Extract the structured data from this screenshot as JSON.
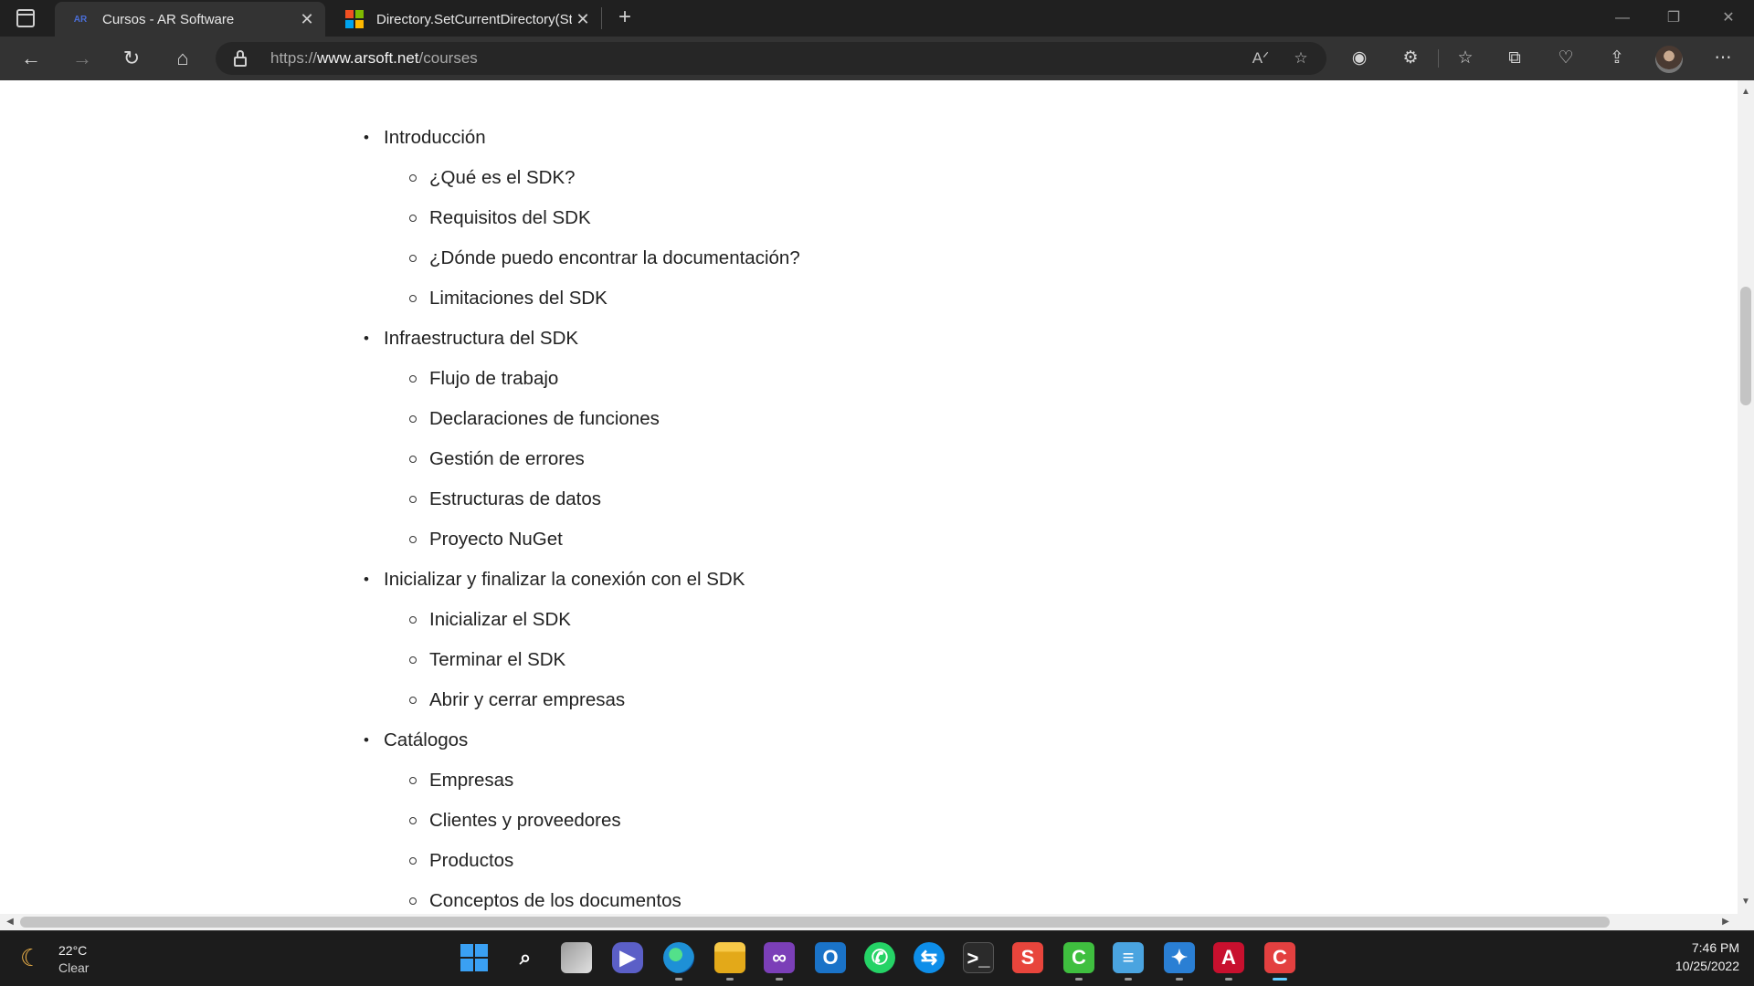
{
  "browser": {
    "tabs": [
      {
        "title": "Cursos - AR Software",
        "favicon": "ar-software-favicon",
        "active": true
      },
      {
        "title": "Directory.SetCurrentDirectory(St",
        "favicon": "microsoft-favicon",
        "active": false
      }
    ],
    "url_prefix": "https://",
    "url_domain": "www.arsoft.net",
    "url_path": "/courses"
  },
  "course_outline": [
    {
      "label": "Introducción",
      "subitems": [
        "¿Qué es el SDK?",
        "Requisitos del SDK",
        "¿Dónde puedo encontrar la documentación?",
        "Limitaciones del SDK"
      ]
    },
    {
      "label": "Infraestructura del SDK",
      "subitems": [
        "Flujo de trabajo",
        "Declaraciones de funciones",
        "Gestión de errores",
        "Estructuras de datos",
        "Proyecto NuGet"
      ]
    },
    {
      "label": "Inicializar y finalizar la conexión con el SDK",
      "subitems": [
        "Inicializar el SDK",
        "Terminar el SDK",
        "Abrir y cerrar empresas"
      ]
    },
    {
      "label": "Catálogos",
      "subitems": [
        "Empresas",
        "Clientes y proveedores",
        "Productos",
        "Conceptos de los documentos"
      ]
    }
  ],
  "taskbar": {
    "weather": {
      "temp": "22°C",
      "condition": "Clear"
    },
    "apps": [
      "start",
      "search",
      "task-view",
      "teams",
      "edge",
      "file-explorer",
      "visual-studio",
      "outlook",
      "whatsapp",
      "teamviewer",
      "terminal",
      "sublime",
      "app-green",
      "notepad",
      "app-blue",
      "acrobat",
      "app-red"
    ],
    "time": "7:46 PM",
    "date": "10/25/2022"
  },
  "colors": {
    "accent": "#60cdff",
    "tab_active": "#333333",
    "chrome": "#202020"
  }
}
